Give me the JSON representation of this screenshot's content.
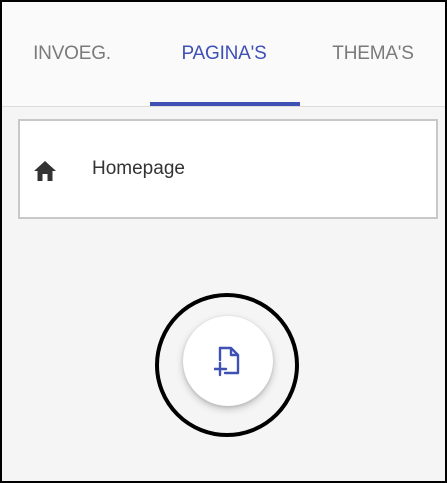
{
  "tabs": [
    {
      "label": "INVOEG.",
      "active": false
    },
    {
      "label": "PAGINA'S",
      "active": true
    },
    {
      "label": "THEMA'S",
      "active": false
    }
  ],
  "pages": [
    {
      "label": "Homepage",
      "icon": "home-icon"
    }
  ],
  "fab": {
    "icon": "add-page-icon"
  },
  "colors": {
    "accent": "#3f51b5",
    "tab_inactive": "#7a7a7a",
    "text": "#333333",
    "background": "#f5f5f5"
  }
}
